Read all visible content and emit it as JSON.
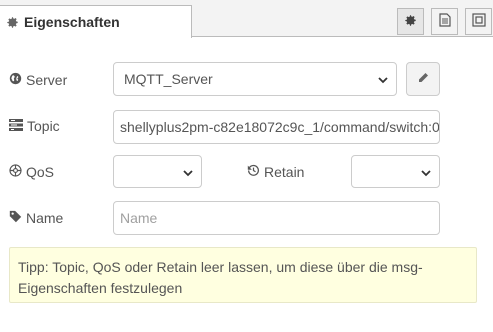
{
  "tab": {
    "title": "Eigenschaften"
  },
  "toolbar": {
    "icons": [
      "gear-icon",
      "document-icon",
      "frame-icon"
    ]
  },
  "server": {
    "label": "Server",
    "value": "MQTT_Server"
  },
  "topic": {
    "label": "Topic",
    "value": "shellyplus2pm-c82e18072c9c_1/command/switch:0"
  },
  "qos": {
    "label": "QoS",
    "value": ""
  },
  "retain": {
    "label": "Retain",
    "value": ""
  },
  "name": {
    "label": "Name",
    "value": "",
    "placeholder": "Name"
  },
  "tip": {
    "text": "Tipp: Topic, QoS oder Retain leer lassen, um diese über die msg-Eigenschaften festzulegen"
  },
  "colors": {
    "tip_background": "#ffffe0",
    "border": "#cccccc",
    "toolbar": "#f3f3f3"
  }
}
